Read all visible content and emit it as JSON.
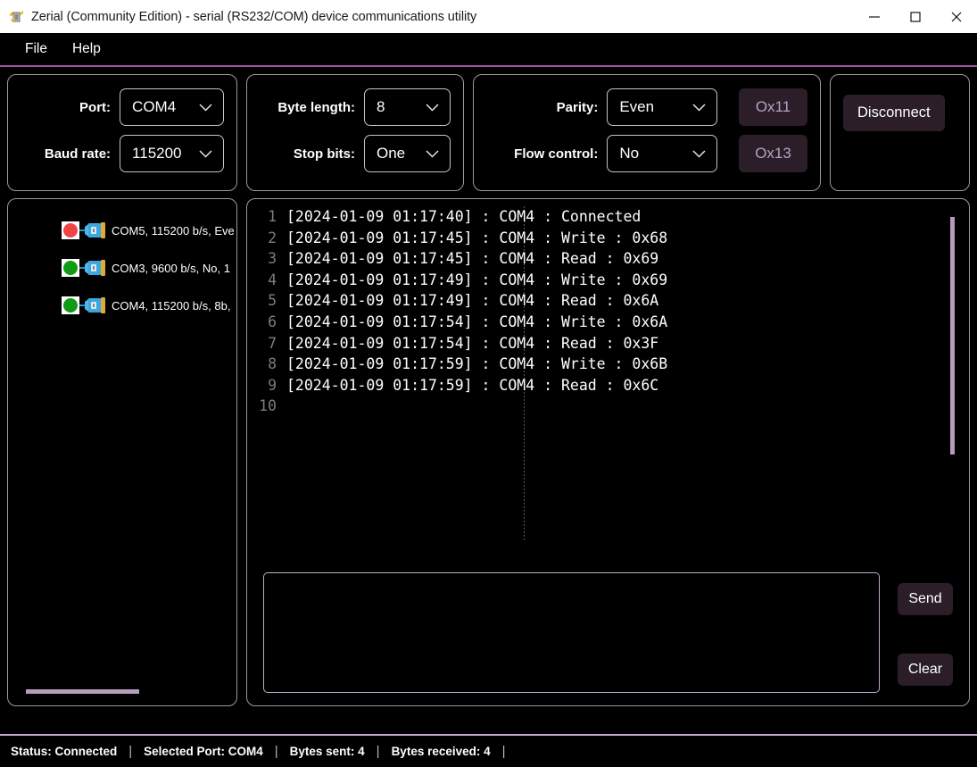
{
  "window": {
    "title": "Zerial (Community Edition) - serial (RS232/COM) device communications utility",
    "icon": "app-icon",
    "minimize": "—",
    "maximize": "□",
    "close": "✕"
  },
  "menubar": {
    "items": [
      {
        "label": "File"
      },
      {
        "label": "Help"
      }
    ],
    "accent_color": "#a050a8"
  },
  "settings": {
    "port_panel": {
      "rows": [
        {
          "label": "Port:",
          "value": "COM4"
        },
        {
          "label": "Baud rate:",
          "value": "115200"
        }
      ]
    },
    "byte_panel": {
      "rows": [
        {
          "label": "Byte length:",
          "value": "8"
        },
        {
          "label": "Stop bits:",
          "value": "One"
        }
      ]
    },
    "parity_panel": {
      "rows": [
        {
          "label": "Parity:",
          "value": "Even",
          "hex": "Ox11"
        },
        {
          "label": "Flow control:",
          "value": "No",
          "hex": "Ox13"
        }
      ]
    },
    "connection_panel": {
      "button": "Disconnect"
    }
  },
  "devices": {
    "items": [
      {
        "status_color": "#ef4444",
        "label": "COM5, 115200 b/s, Eve"
      },
      {
        "status_color": "#0f9b14",
        "label": "COM3, 9600 b/s, No, 1 "
      },
      {
        "status_color": "#0f9b14",
        "label": "COM4, 115200 b/s, 8b,"
      }
    ]
  },
  "log": {
    "lines": [
      {
        "n": "1",
        "text": "[2024-01-09 01:17:40] : COM4 : Connected"
      },
      {
        "n": "2",
        "text": "[2024-01-09 01:17:45] : COM4 : Write : 0x68"
      },
      {
        "n": "3",
        "text": "[2024-01-09 01:17:45] : COM4 : Read : 0x69"
      },
      {
        "n": "4",
        "text": "[2024-01-09 01:17:49] : COM4 : Write : 0x69"
      },
      {
        "n": "5",
        "text": "[2024-01-09 01:17:49] : COM4 : Read : 0x6A"
      },
      {
        "n": "6",
        "text": "[2024-01-09 01:17:54] : COM4 : Write : 0x6A"
      },
      {
        "n": "7",
        "text": "[2024-01-09 01:17:54] : COM4 : Read : 0x3F"
      },
      {
        "n": "8",
        "text": "[2024-01-09 01:17:59] : COM4 : Write : 0x6B"
      },
      {
        "n": "9",
        "text": "[2024-01-09 01:17:59] : COM4 : Read : 0x6C"
      },
      {
        "n": "10",
        "text": ""
      }
    ]
  },
  "send": {
    "input_value": "",
    "input_placeholder": "",
    "send_label": "Send",
    "clear_label": "Clear"
  },
  "statusbar": {
    "status": "Status: Connected",
    "selected_port": "Selected Port: COM4",
    "bytes_sent": "Bytes sent: 4",
    "bytes_received": "Bytes received: 4",
    "separator": "|"
  }
}
